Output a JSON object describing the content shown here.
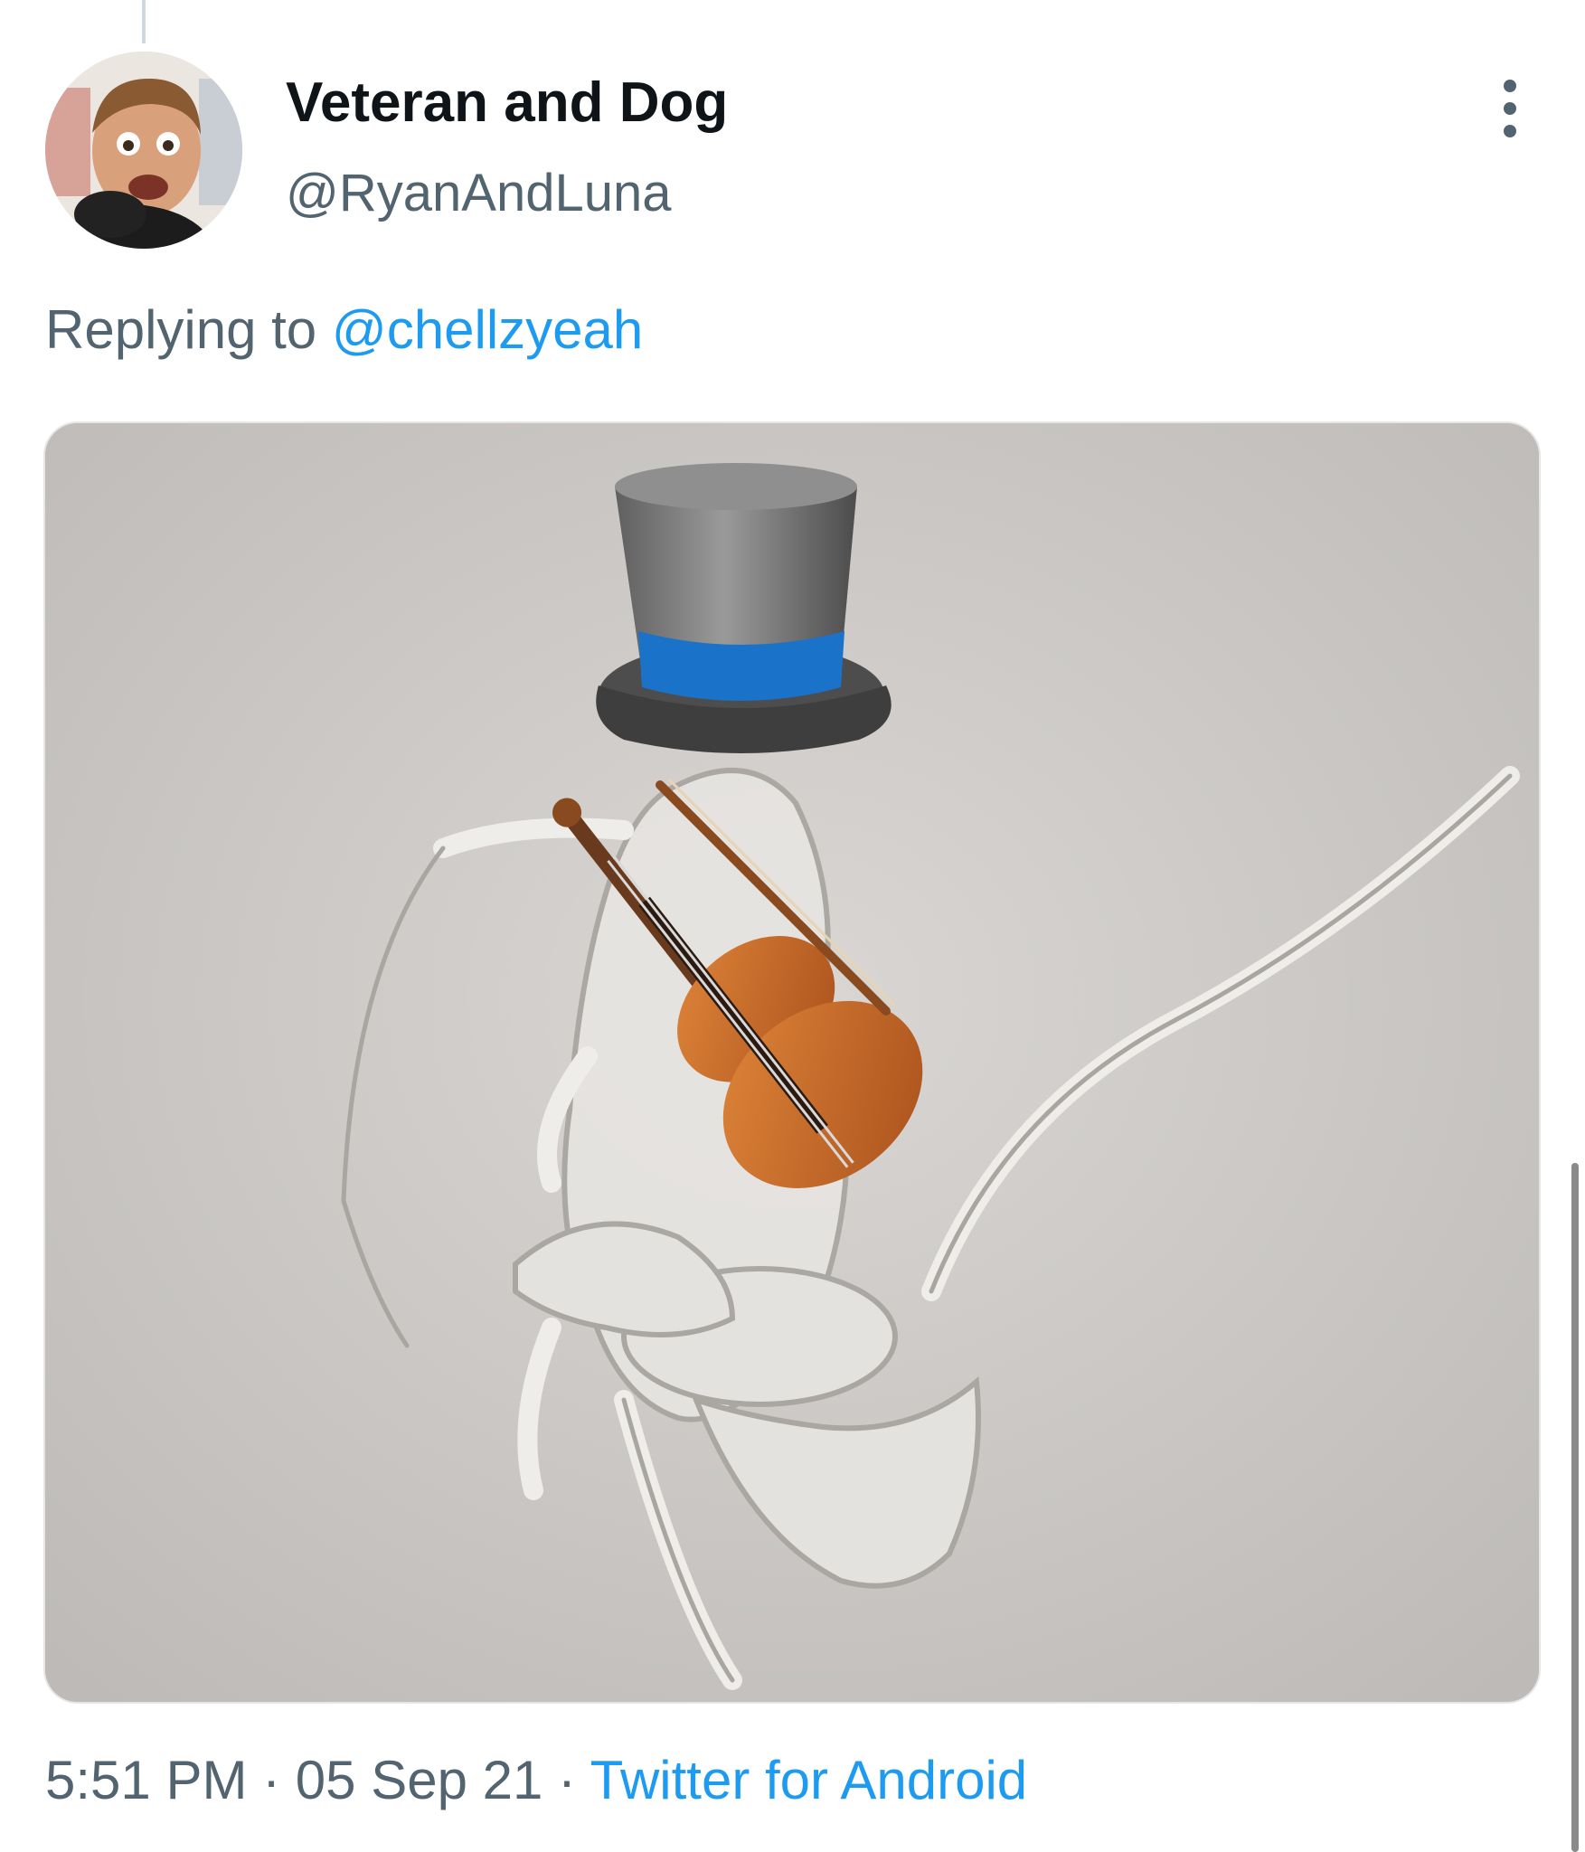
{
  "tweet": {
    "display_name": "Veteran and Dog",
    "handle": "@RyanAndLuna",
    "replying_prefix": "Replying to",
    "replying_to": "@chellzyeah",
    "time": "5:51 PM",
    "separator": "·",
    "date": "05 Sep 21",
    "source": "Twitter for Android"
  },
  "icons": {
    "more": "more-vertical-icon"
  },
  "colors": {
    "name": "#0f1419",
    "secondary": "#536471",
    "link": "#1d9bf0"
  }
}
